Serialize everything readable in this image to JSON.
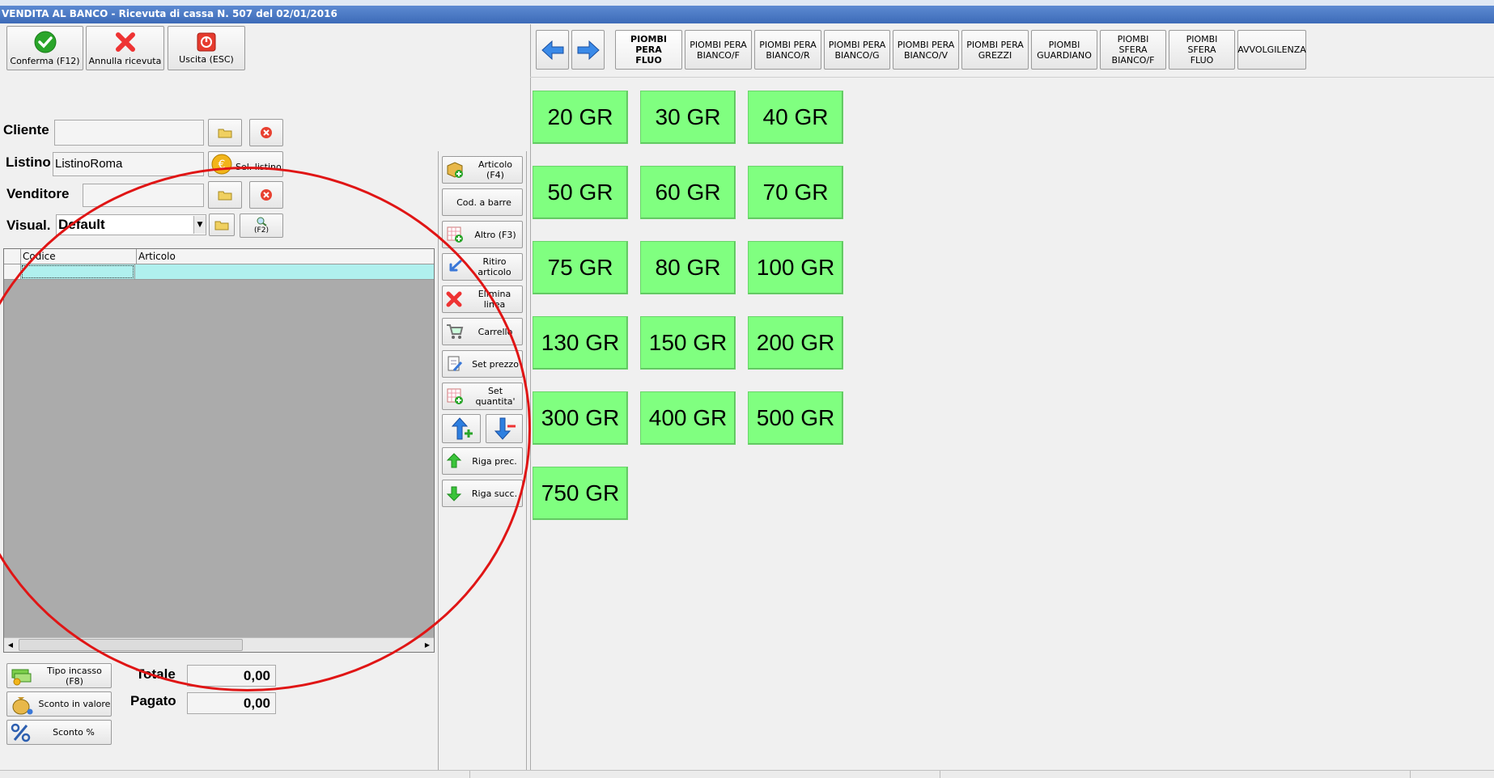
{
  "window": {
    "title": "VENDITA AL BANCO - Ricevuta di cassa N. 507 del 02/01/2016"
  },
  "toolbar": {
    "confirm_label": "Conferma (F12)",
    "cancel_label": "Annulla ricevuta",
    "exit_label": "Uscita (ESC)"
  },
  "form": {
    "cliente_label": "Cliente",
    "cliente_value": "",
    "listino_label": "Listino",
    "listino_value": "ListinoRoma",
    "sel_listino_label": "Sel. listino",
    "venditore_label": "Venditore",
    "venditore_value": "",
    "visual_label": "Visual.",
    "visual_value": "Default",
    "f2_label": "(F2)"
  },
  "grid": {
    "columns": [
      "Codice",
      "Articolo"
    ]
  },
  "side_buttons": {
    "articolo": "Articolo (F4)",
    "barcode": "Cod. a barre",
    "altro": "Altro (F3)",
    "ritiro": "Ritiro articolo",
    "elimina": "Elimina linea",
    "carrello": "Carrello",
    "set_prezzo": "Set prezzo",
    "set_quantita": "Set quantita'",
    "riga_prec": "Riga prec.",
    "riga_succ": "Riga succ."
  },
  "bottom": {
    "tipo_incasso": "Tipo incasso (F8)",
    "sconto_valore": "Sconto in valore",
    "sconto_perc": "Sconto %",
    "totale_label": "Totale",
    "totale_value": "0,00",
    "pagato_label": "Pagato",
    "pagato_value": "0,00"
  },
  "categories": [
    {
      "line1": "PIOMBI PERA",
      "line2": "FLUO"
    },
    {
      "line1": "PIOMBI PERA",
      "line2": "BIANCO/F"
    },
    {
      "line1": "PIOMBI PERA",
      "line2": "BIANCO/R"
    },
    {
      "line1": "PIOMBI PERA",
      "line2": "BIANCO/G"
    },
    {
      "line1": "PIOMBI PERA",
      "line2": "BIANCO/V"
    },
    {
      "line1": "PIOMBI PERA",
      "line2": "GREZZI"
    },
    {
      "line1": "PIOMBI",
      "line2": "GUARDIANO"
    },
    {
      "line1": "PIOMBI SFERA",
      "line2": "BIANCO/F"
    },
    {
      "line1": "PIOMBI SFERA",
      "line2": "FLUO"
    },
    {
      "line1": "AVVOLGILENZA",
      "line2": ""
    }
  ],
  "weights": [
    "20 GR",
    "30 GR",
    "40 GR",
    "50 GR",
    "60 GR",
    "70 GR",
    "75 GR",
    "80 GR",
    "100 GR",
    "130 GR",
    "150 GR",
    "200 GR",
    "300 GR",
    "400 GR",
    "500 GR",
    "750 GR"
  ],
  "colors": {
    "weight_button": "#80ff80",
    "selected_row": "#b0f0ee",
    "grid_empty": "#ababab",
    "annotation_circle": "#e01515",
    "title_bar": "#3d6bb8"
  }
}
